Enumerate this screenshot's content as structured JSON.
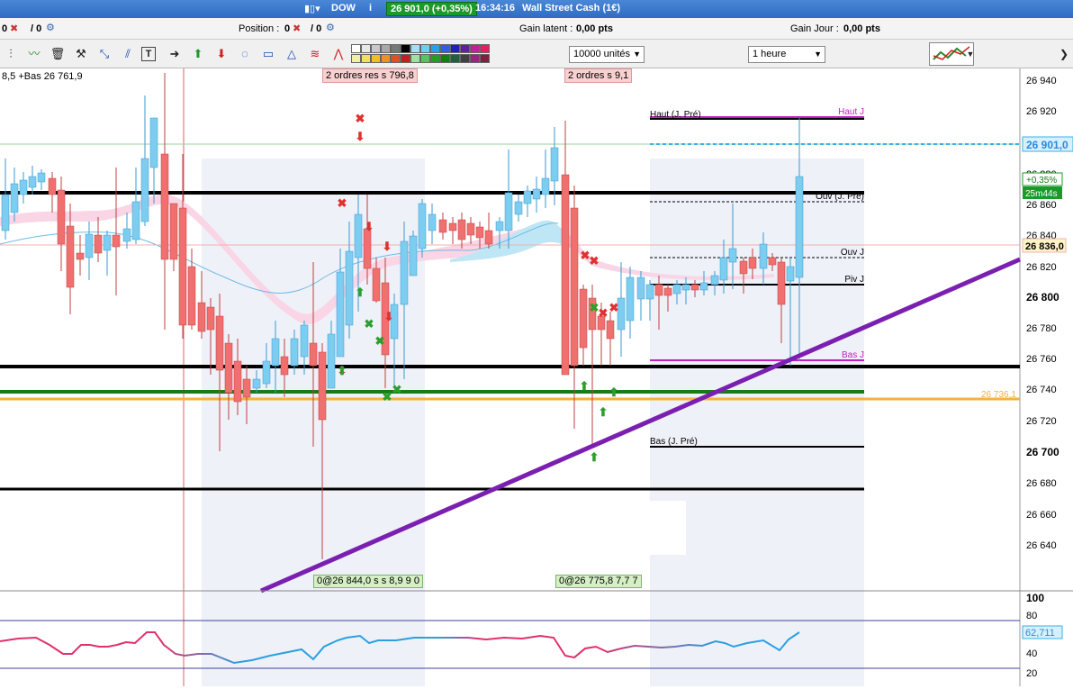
{
  "titlebar": {
    "symbol": "DOW",
    "info_icon": "i",
    "price_change": "26 901,0 (+0,35%)",
    "time": "16:34:16",
    "instrument": "Wall Street Cash (1€)"
  },
  "status": {
    "left_a": "0",
    "left_b": "/ 0",
    "position_label": "Position :",
    "position_value": "0",
    "position_slash": "/ 0",
    "gain_latent_label": "Gain latent :",
    "gain_latent_value": "0,00 pts",
    "gain_jour_label": "Gain Jour :",
    "gain_jour_value": "0,00 pts"
  },
  "toolbar": {
    "units_select": "10000 unités",
    "timeframe_select": "1 heure",
    "icons": [
      "bars-icon",
      "zigzag-icon",
      "trash-icon",
      "tools-icon",
      "cross-icon",
      "parallel-icon",
      "text-icon",
      "arrow-right-icon",
      "arrow-up-icon",
      "arrow-down-icon",
      "lasso-icon",
      "rectangle-icon",
      "triangle-icon",
      "fib-icon",
      "fib-fan-icon"
    ],
    "swatch_colors": [
      "#ffffff",
      "#e8e8e8",
      "#c8c8c8",
      "#a8a8a8",
      "#787878",
      "#000000",
      "#a6e0f0",
      "#6ad0f0",
      "#2aa0e8",
      "#3060e0",
      "#2020c0",
      "#6020a0",
      "#c020a0",
      "#e02060",
      "#f0f0a0",
      "#f0e060",
      "#f0c020",
      "#f09020",
      "#e05020",
      "#c02020",
      "#a0e0a0",
      "#60c060",
      "#20a020",
      "#108010",
      "#206040",
      "#404040",
      "#a02080",
      "#802040"
    ]
  },
  "chart": {
    "price_labels": [
      "26 940",
      "26 920",
      "26 880",
      "26 860",
      "26 840",
      "26 820",
      "26 800",
      "26 780",
      "26 760",
      "26 740",
      "26 720",
      "26 700",
      "26 680",
      "26 660",
      "26 640"
    ],
    "current_price_tag": "26 901,0",
    "change_tag": "+0,35%",
    "countdown_tag": "25m44s",
    "ref_price_tag": "26 836,0",
    "orange_level_tag": "26 736,1",
    "top_left_info": "8,5 +Bas 26 761,9",
    "order_tag_1": "2 ordres res",
    "order_tag_1_value": "s 796,8",
    "order_tag_2": "2 ordres",
    "order_tag_2_value": "s 9,1",
    "level_labels": {
      "haut_j_pre": "Haut (J. Pré)",
      "haut_j": "Haut J",
      "ouv_j_pre": "Ouv (J. Pré)",
      "ouv_j": "Ouv J",
      "piv_j": "Piv J",
      "bas_j": "Bas J",
      "bas_j_pre": "Bas (J. Pré)"
    },
    "bottom_tag_1": [
      "0@26 844,0",
      "s",
      "s",
      "8,9",
      "9",
      "0"
    ],
    "bottom_tag_2": [
      "0@26 775,8",
      "7,7",
      "7"
    ]
  },
  "oscillator": {
    "labels": [
      "100",
      "80",
      "40",
      "20"
    ],
    "value_tag": "62,711"
  },
  "colors": {
    "bull": "#7dcdf0",
    "bear": "#f07070",
    "trendline": "#7b1fb0",
    "green_level": "#1a7a1a",
    "orange_level": "#f5b041",
    "magenta_level": "#c020c0"
  }
}
